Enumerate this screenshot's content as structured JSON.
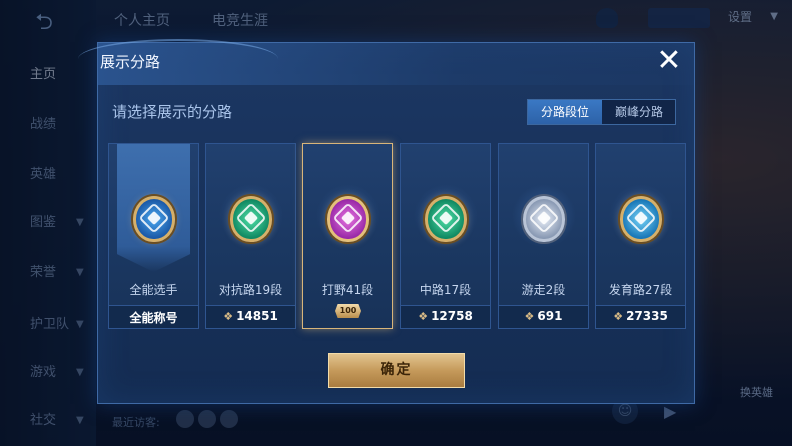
{
  "background": {
    "back_label": "⮌",
    "top_tabs": [
      "个人主页",
      "电竞生涯"
    ],
    "settings_label": "设置",
    "side_nav": [
      {
        "label": "主页",
        "has_chevron": false,
        "active": true
      },
      {
        "label": "战绩",
        "has_chevron": false,
        "active": false
      },
      {
        "label": "英雄",
        "has_chevron": false,
        "active": false
      },
      {
        "label": "图鉴",
        "has_chevron": true,
        "active": false
      },
      {
        "label": "荣誉",
        "has_chevron": true,
        "active": false
      },
      {
        "label": "护卫队",
        "has_chevron": true,
        "active": false
      },
      {
        "label": "游戏",
        "has_chevron": true,
        "active": false
      },
      {
        "label": "社交",
        "has_chevron": true,
        "active": false
      }
    ],
    "recent_visits_label": "最近访客:",
    "swap_hero_label": "换英雄"
  },
  "modal": {
    "title": "展示分路",
    "close_label": "✕",
    "subtitle": "请选择展示的分路",
    "toggle": [
      {
        "label": "分路段位",
        "active": true
      },
      {
        "label": "巅峰分路",
        "active": false
      }
    ],
    "cards": [
      {
        "name": "全能选手",
        "footer": "全能称号",
        "icon": "all-round-emblem",
        "style": "blue",
        "selected": false,
        "score": ""
      },
      {
        "name": "对抗路19段",
        "footer": "",
        "icon": "clash-lane-emblem",
        "style": "green",
        "selected": false,
        "score": "14851"
      },
      {
        "name": "打野41段",
        "footer": "",
        "icon": "jungle-emblem",
        "style": "purple",
        "selected": true,
        "score": "",
        "rank_plate": "100"
      },
      {
        "name": "中路17段",
        "footer": "",
        "icon": "mid-lane-emblem",
        "style": "green",
        "selected": false,
        "score": "12758"
      },
      {
        "name": "游走2段",
        "footer": "",
        "icon": "roam-emblem",
        "style": "silver",
        "selected": false,
        "score": "691"
      },
      {
        "name": "发育路27段",
        "footer": "",
        "icon": "farm-lane-emblem",
        "style": "teal",
        "selected": false,
        "score": "27335"
      }
    ],
    "lane_point_glyph": "❖",
    "confirm_label": "确定"
  },
  "colors": {
    "accent_gold": "#d6b06a",
    "panel_blue": "#1c3763",
    "toggle_active": "#3a78c4"
  }
}
